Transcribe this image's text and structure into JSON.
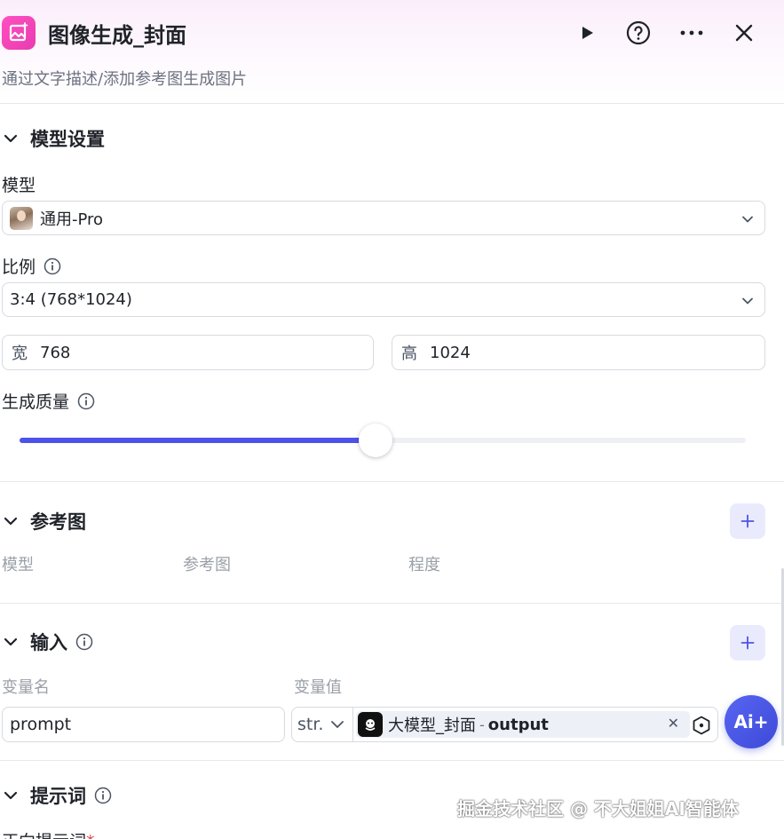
{
  "header": {
    "title": "图像生成_封面",
    "subtitle": "通过文字描述/添加参考图生成图片"
  },
  "model_settings": {
    "section_label": "模型设置",
    "model_label": "模型",
    "model_value": "通用-Pro",
    "ratio_label": "比例",
    "ratio_value": "3:4 (768*1024)",
    "width_prefix": "宽",
    "width_value": "768",
    "height_prefix": "高",
    "height_value": "1024",
    "quality_label": "生成质量",
    "quality_level": 0.49
  },
  "reference": {
    "section_label": "参考图",
    "columns": [
      "模型",
      "参考图",
      "程度"
    ]
  },
  "input": {
    "section_label": "输入",
    "columns": [
      "变量名",
      "变量值"
    ],
    "rows": [
      {
        "name": "prompt",
        "type": "str.",
        "ref_node": "大模型_封面",
        "separator": "-",
        "ref_output": "output"
      }
    ]
  },
  "prompt_section": {
    "section_label": "提示词",
    "positive_label": "正向提示词",
    "required_mark": "*"
  },
  "ai_button": {
    "label": "Ai+"
  },
  "watermark": "掘金技术社区 @ 不大姐姐AI智能体",
  "colors": {
    "accent": "#4d53e8",
    "app_icon": "#ff4fc2",
    "required": "#e5484d"
  }
}
